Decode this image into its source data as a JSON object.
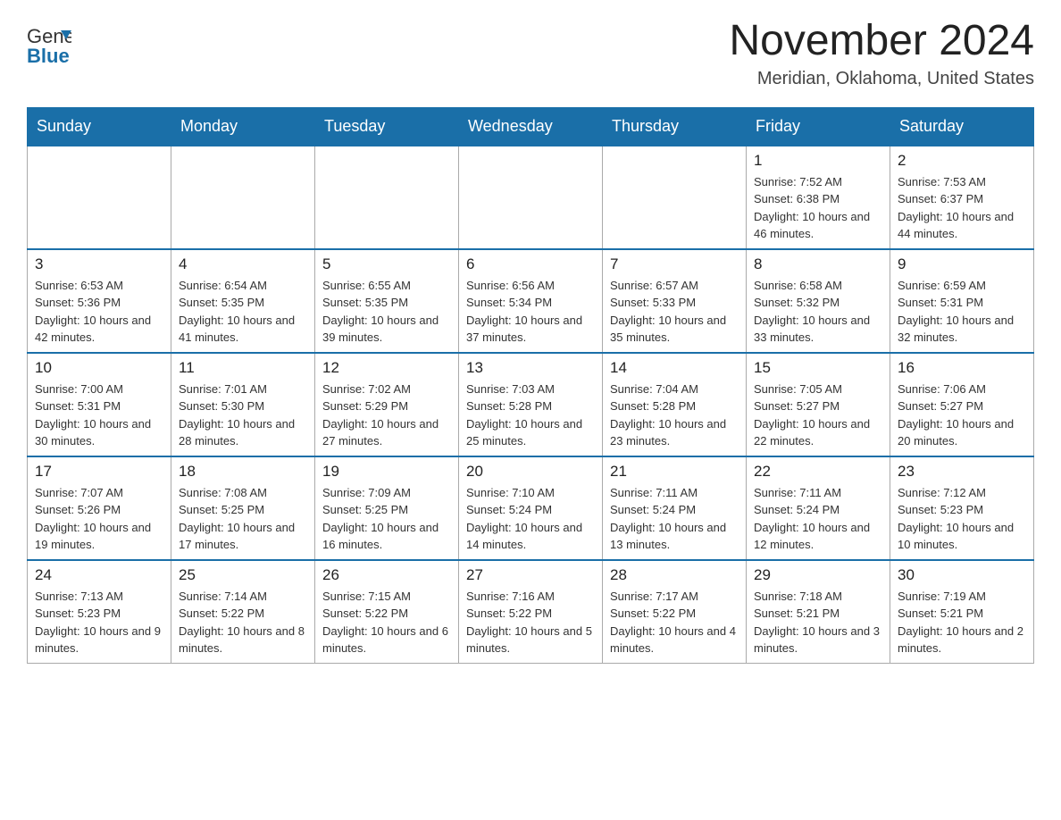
{
  "header": {
    "logo_general": "General",
    "logo_blue": "Blue",
    "month_title": "November 2024",
    "location": "Meridian, Oklahoma, United States"
  },
  "weekdays": [
    "Sunday",
    "Monday",
    "Tuesday",
    "Wednesday",
    "Thursday",
    "Friday",
    "Saturday"
  ],
  "weeks": [
    [
      {
        "day": "",
        "empty": true
      },
      {
        "day": "",
        "empty": true
      },
      {
        "day": "",
        "empty": true
      },
      {
        "day": "",
        "empty": true
      },
      {
        "day": "",
        "empty": true
      },
      {
        "day": "1",
        "sunrise": "7:52 AM",
        "sunset": "6:38 PM",
        "daylight": "10 hours and 46 minutes."
      },
      {
        "day": "2",
        "sunrise": "7:53 AM",
        "sunset": "6:37 PM",
        "daylight": "10 hours and 44 minutes."
      }
    ],
    [
      {
        "day": "3",
        "sunrise": "6:53 AM",
        "sunset": "5:36 PM",
        "daylight": "10 hours and 42 minutes."
      },
      {
        "day": "4",
        "sunrise": "6:54 AM",
        "sunset": "5:35 PM",
        "daylight": "10 hours and 41 minutes."
      },
      {
        "day": "5",
        "sunrise": "6:55 AM",
        "sunset": "5:35 PM",
        "daylight": "10 hours and 39 minutes."
      },
      {
        "day": "6",
        "sunrise": "6:56 AM",
        "sunset": "5:34 PM",
        "daylight": "10 hours and 37 minutes."
      },
      {
        "day": "7",
        "sunrise": "6:57 AM",
        "sunset": "5:33 PM",
        "daylight": "10 hours and 35 minutes."
      },
      {
        "day": "8",
        "sunrise": "6:58 AM",
        "sunset": "5:32 PM",
        "daylight": "10 hours and 33 minutes."
      },
      {
        "day": "9",
        "sunrise": "6:59 AM",
        "sunset": "5:31 PM",
        "daylight": "10 hours and 32 minutes."
      }
    ],
    [
      {
        "day": "10",
        "sunrise": "7:00 AM",
        "sunset": "5:31 PM",
        "daylight": "10 hours and 30 minutes."
      },
      {
        "day": "11",
        "sunrise": "7:01 AM",
        "sunset": "5:30 PM",
        "daylight": "10 hours and 28 minutes."
      },
      {
        "day": "12",
        "sunrise": "7:02 AM",
        "sunset": "5:29 PM",
        "daylight": "10 hours and 27 minutes."
      },
      {
        "day": "13",
        "sunrise": "7:03 AM",
        "sunset": "5:28 PM",
        "daylight": "10 hours and 25 minutes."
      },
      {
        "day": "14",
        "sunrise": "7:04 AM",
        "sunset": "5:28 PM",
        "daylight": "10 hours and 23 minutes."
      },
      {
        "day": "15",
        "sunrise": "7:05 AM",
        "sunset": "5:27 PM",
        "daylight": "10 hours and 22 minutes."
      },
      {
        "day": "16",
        "sunrise": "7:06 AM",
        "sunset": "5:27 PM",
        "daylight": "10 hours and 20 minutes."
      }
    ],
    [
      {
        "day": "17",
        "sunrise": "7:07 AM",
        "sunset": "5:26 PM",
        "daylight": "10 hours and 19 minutes."
      },
      {
        "day": "18",
        "sunrise": "7:08 AM",
        "sunset": "5:25 PM",
        "daylight": "10 hours and 17 minutes."
      },
      {
        "day": "19",
        "sunrise": "7:09 AM",
        "sunset": "5:25 PM",
        "daylight": "10 hours and 16 minutes."
      },
      {
        "day": "20",
        "sunrise": "7:10 AM",
        "sunset": "5:24 PM",
        "daylight": "10 hours and 14 minutes."
      },
      {
        "day": "21",
        "sunrise": "7:11 AM",
        "sunset": "5:24 PM",
        "daylight": "10 hours and 13 minutes."
      },
      {
        "day": "22",
        "sunrise": "7:11 AM",
        "sunset": "5:24 PM",
        "daylight": "10 hours and 12 minutes."
      },
      {
        "day": "23",
        "sunrise": "7:12 AM",
        "sunset": "5:23 PM",
        "daylight": "10 hours and 10 minutes."
      }
    ],
    [
      {
        "day": "24",
        "sunrise": "7:13 AM",
        "sunset": "5:23 PM",
        "daylight": "10 hours and 9 minutes."
      },
      {
        "day": "25",
        "sunrise": "7:14 AM",
        "sunset": "5:22 PM",
        "daylight": "10 hours and 8 minutes."
      },
      {
        "day": "26",
        "sunrise": "7:15 AM",
        "sunset": "5:22 PM",
        "daylight": "10 hours and 6 minutes."
      },
      {
        "day": "27",
        "sunrise": "7:16 AM",
        "sunset": "5:22 PM",
        "daylight": "10 hours and 5 minutes."
      },
      {
        "day": "28",
        "sunrise": "7:17 AM",
        "sunset": "5:22 PM",
        "daylight": "10 hours and 4 minutes."
      },
      {
        "day": "29",
        "sunrise": "7:18 AM",
        "sunset": "5:21 PM",
        "daylight": "10 hours and 3 minutes."
      },
      {
        "day": "30",
        "sunrise": "7:19 AM",
        "sunset": "5:21 PM",
        "daylight": "10 hours and 2 minutes."
      }
    ]
  ],
  "labels": {
    "sunrise_prefix": "Sunrise: ",
    "sunset_prefix": "Sunset: ",
    "daylight_prefix": "Daylight: "
  }
}
